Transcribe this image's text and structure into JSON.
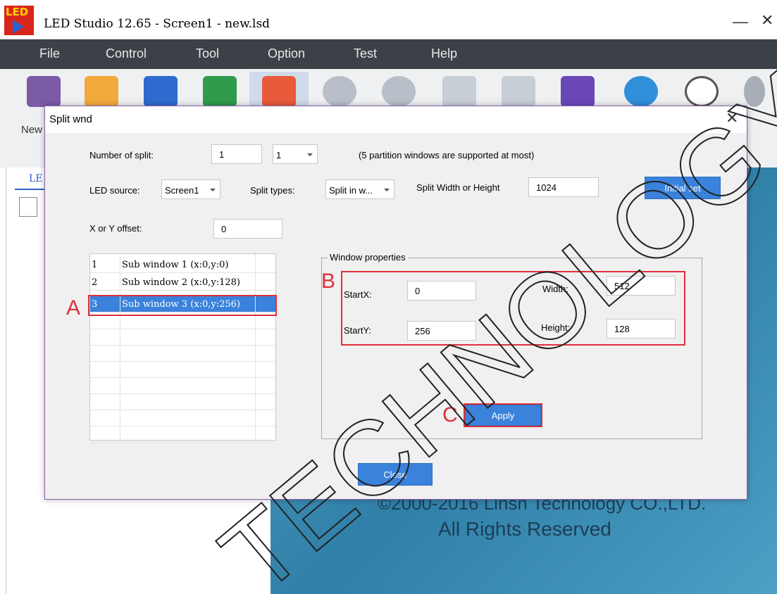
{
  "app": {
    "logo_text": "LED",
    "title": "LED Studio 12.65 - Screen1 - new.lsd",
    "min_glyph": "—",
    "close_glyph": "✕"
  },
  "menu": [
    "File",
    "Control",
    "Tool",
    "Option",
    "Test",
    "Help"
  ],
  "toolbar": {
    "new_label": "New",
    "icons": [
      "new-folder-icon",
      "open-icon",
      "save-icon",
      "window-icon",
      "edit-icon",
      "play-icon",
      "pause-icon",
      "stop-icon",
      "square-icon",
      "split-icon",
      "screen-icon",
      "cloud-icon",
      "user-icon"
    ]
  },
  "left_panel": {
    "tab_label": "LE"
  },
  "splash": {
    "copyright": "©2000-2016 Linsn Technology CO.,LTD.",
    "rights": "All Rights Reserved"
  },
  "watermark": "TECHNOLOGY",
  "dialog": {
    "title": "Split wnd",
    "close_glyph": "✕",
    "number_of_split_label": "Number of split:",
    "number_of_split_value": "1",
    "number_of_split_combo": "1",
    "support_note": "(5 partition windows are supported at most)",
    "led_source_label": "LED source:",
    "led_source_value": "Screen1",
    "split_types_label": "Split types:",
    "split_types_value": "Split in w...",
    "split_wh_label": "Split Width or Height",
    "split_wh_value": "1024",
    "initial_set_button": "Initial set",
    "offset_label": "X or Y offset:",
    "offset_value": "0",
    "sub_windows": [
      {
        "num": "1",
        "label": "Sub window 1 (x:0,y:0)"
      },
      {
        "num": "2",
        "label": "Sub window 2 (x:0,y:128)"
      },
      {
        "num": "3",
        "label": "Sub window 3 (x:0,y:256)"
      }
    ],
    "props_legend": "Window properties",
    "startx_label": "StartX:",
    "startx_value": "0",
    "width_label": "Width:",
    "width_value": "512",
    "starty_label": "StartY:",
    "starty_value": "256",
    "height_label": "Height:",
    "height_value": "128",
    "apply_button": "Apply",
    "close_button": "Close"
  },
  "annotations": {
    "a": "A",
    "b": "B",
    "c": "C"
  }
}
